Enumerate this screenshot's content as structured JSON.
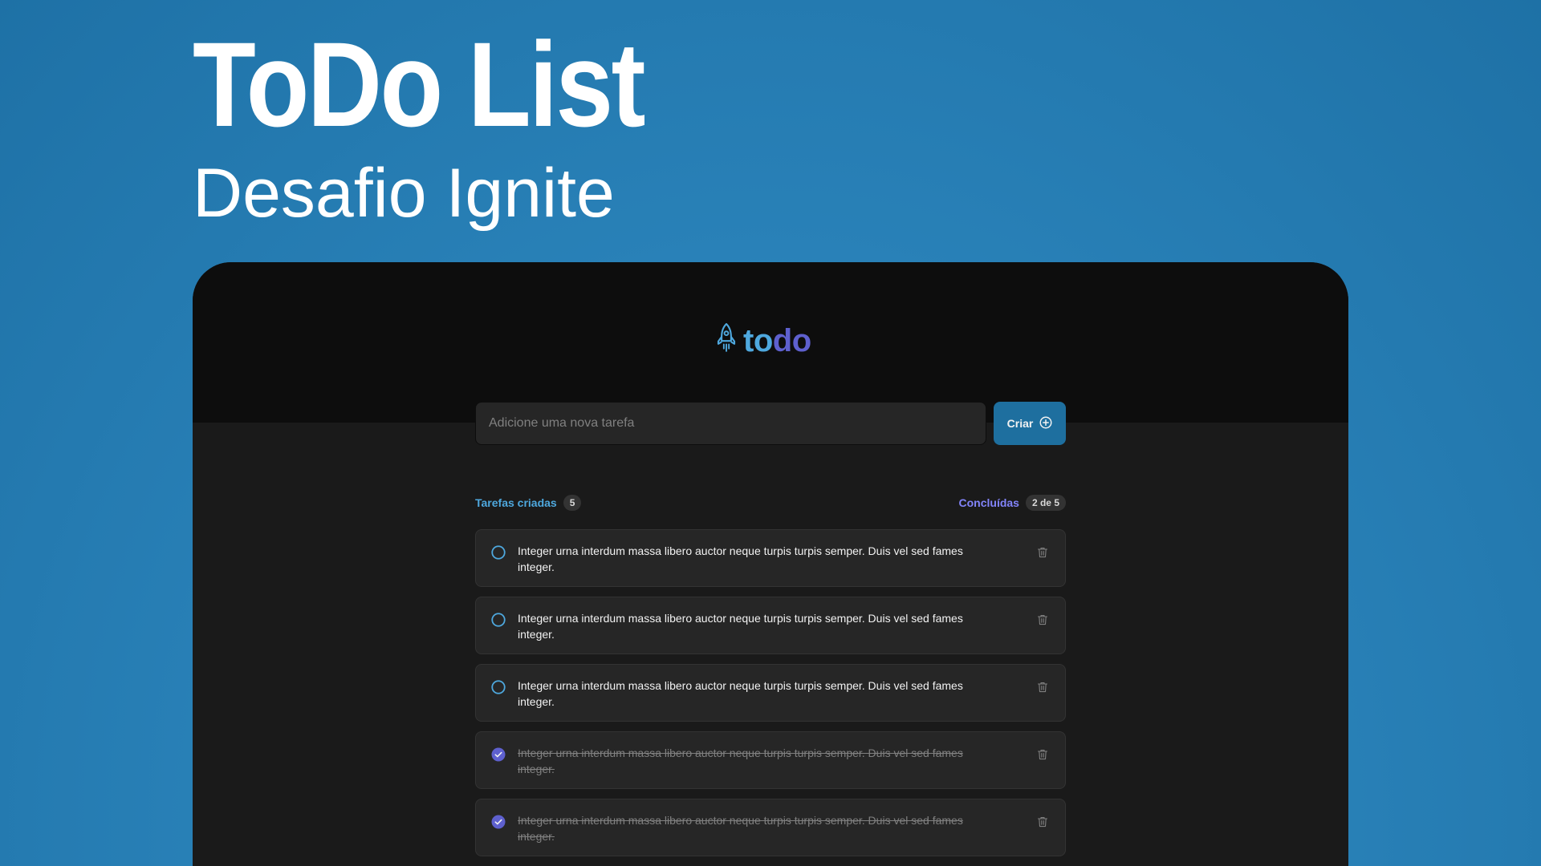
{
  "hero": {
    "title": "ToDo List",
    "subtitle": "Desafio Ignite"
  },
  "app": {
    "logo": {
      "icon": "rocket-icon",
      "text_to": "to",
      "text_do": "do"
    },
    "new_task": {
      "placeholder": "Adicione uma nova tarefa",
      "value": "",
      "button_label": "Criar",
      "button_icon": "plus-circle-icon"
    },
    "counters": {
      "created_label": "Tarefas criadas",
      "created_count": "5",
      "done_label": "Concluídas",
      "done_count": "2 de 5"
    },
    "tasks": [
      {
        "text": "Integer urna interdum massa libero auctor neque turpis turpis semper. Duis vel sed fames integer.",
        "done": false
      },
      {
        "text": "Integer urna interdum massa libero auctor neque turpis turpis semper. Duis vel sed fames integer.",
        "done": false
      },
      {
        "text": "Integer urna interdum massa libero auctor neque turpis turpis semper. Duis vel sed fames integer.",
        "done": false
      },
      {
        "text": "Integer urna interdum massa libero auctor neque turpis turpis semper. Duis vel sed fames integer.",
        "done": true
      },
      {
        "text": "Integer urna interdum massa libero auctor neque turpis turpis semper. Duis vel sed fames integer.",
        "done": true
      }
    ],
    "colors": {
      "blue": "#4ea8de",
      "blue_dark": "#1e6f9f",
      "purple": "#8284fa",
      "purple_dark": "#5e60ce",
      "background": "#1a1a1a",
      "header_background": "#0d0d0d"
    }
  }
}
